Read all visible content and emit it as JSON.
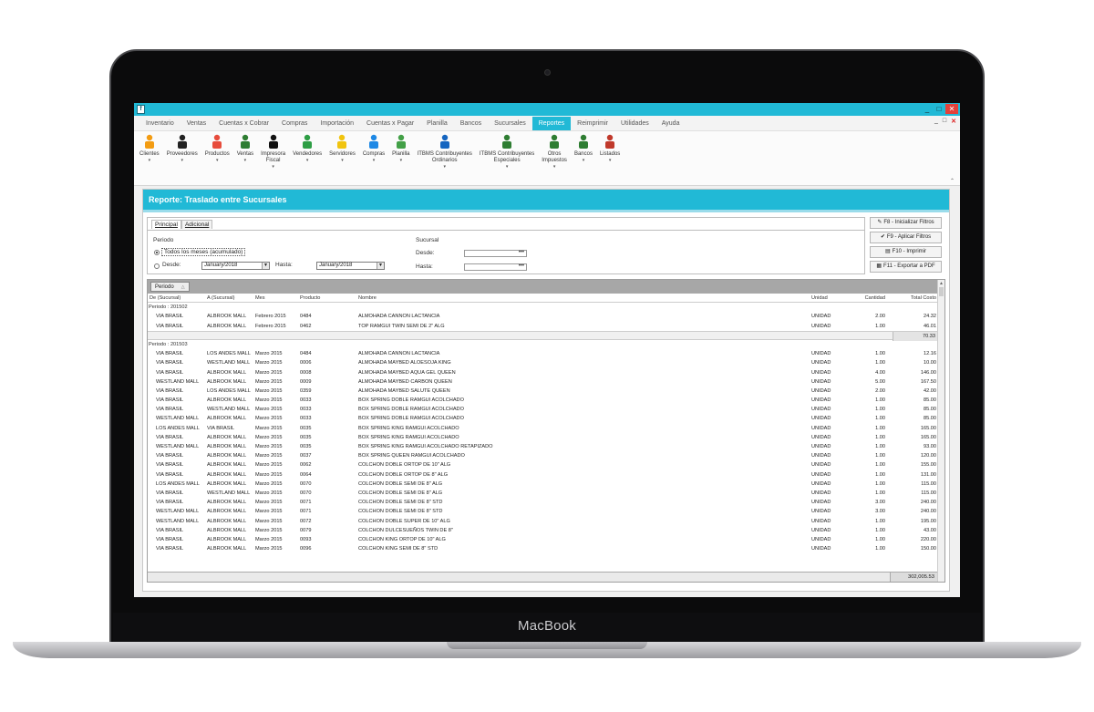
{
  "device_label": "MacBook",
  "window": {
    "app_icon": "f",
    "controls": [
      "_",
      "□",
      "✕"
    ],
    "mdi_controls": [
      "_",
      "□",
      "✕"
    ]
  },
  "menus": [
    "Inventario",
    "Ventas",
    "Cuentas x Cobrar",
    "Compras",
    "Importación",
    "Cuentas x Pagar",
    "Planilla",
    "Bancos",
    "Sucursales",
    "Reportes",
    "Reimprimir",
    "Utilidades",
    "Ayuda"
  ],
  "active_menu": "Reportes",
  "ribbon": [
    {
      "label": "Clientes",
      "icon": "person-orange-icon",
      "color": "#f39c12"
    },
    {
      "label": "Proveedores",
      "icon": "person-black-icon",
      "color": "#222222"
    },
    {
      "label": "Productos",
      "icon": "products-icon",
      "color": "#e74c3c"
    },
    {
      "label": "Ventas",
      "icon": "sales-icon",
      "color": "#2e7d32"
    },
    {
      "label": "Impresora\nFiscal",
      "icon": "printer-icon",
      "color": "#111111"
    },
    {
      "label": "Vendedores",
      "icon": "person-green-icon",
      "color": "#2e9e45"
    },
    {
      "label": "Servidores",
      "icon": "person-yellow-icon",
      "color": "#f1c40f"
    },
    {
      "label": "Compras",
      "icon": "purchases-icon",
      "color": "#1e88e5"
    },
    {
      "label": "Planilla",
      "icon": "payroll-icon",
      "color": "#43a047"
    },
    {
      "label": "ITBMS Contribuyentes\nOrdinarios",
      "icon": "tax-ordinary-icon",
      "color": "#1565c0"
    },
    {
      "label": "ITBMS Contribuyentes\nEspeciales",
      "icon": "tax-special-icon",
      "color": "#2e7d32"
    },
    {
      "label": "Otros\nImpuestos",
      "icon": "other-taxes-icon",
      "color": "#2e7d32"
    },
    {
      "label": "Bancos",
      "icon": "bank-icon",
      "color": "#2e7d32"
    },
    {
      "label": "Listados",
      "icon": "listings-icon",
      "color": "#c0392b"
    }
  ],
  "report": {
    "title": "Reporte: Traslado entre Sucursales",
    "tabs": [
      "Principal",
      "Adicional"
    ],
    "periodo_label": "Periodo",
    "option_all": "Todos los meses (acumulado)",
    "desde_label": "Desde:",
    "desde_value": "January/2018",
    "hasta_label": "Hasta:",
    "hasta_value": "January/2018",
    "sucursal_label": "Sucursal",
    "suc_desde_label": "Desde:",
    "suc_hasta_label": "Hasta:",
    "field_btn": "•••",
    "buttons": [
      "F8 - Inicializar Filtros",
      "F9 - Aplicar Filtros",
      "F10 - Imprimir",
      "F11 - Exportar a PDF"
    ]
  },
  "grid": {
    "group_chip": "Periodo",
    "columns": [
      "De (Sucursal)",
      "A (Sucursal)",
      "Mes",
      "Producto",
      "Nombre",
      "Unidad",
      "Cantidad",
      "Total Costo"
    ],
    "groups": [
      {
        "label": "Periodo : 201502",
        "subtotal": "70.33",
        "rows": [
          [
            "VIA BRASIL",
            "ALBROOK MALL",
            "Febrero 2015",
            "0484",
            "ALMOHADA CANNON LACTANCIA",
            "UNIDAD",
            "2.00",
            "24.32"
          ],
          [
            "VIA BRASIL",
            "ALBROOK MALL",
            "Febrero 2015",
            "0462",
            "TOP RAMGUI TWIN SEMI DE 2\" ALG",
            "UNIDAD",
            "1.00",
            "46.01"
          ]
        ]
      },
      {
        "label": "Periodo : 201503",
        "rows": [
          [
            "VIA BRASIL",
            "LOS ANDES MALL",
            "Marzo 2015",
            "0484",
            "ALMOHADA CANNON LACTANCIA",
            "UNIDAD",
            "1.00",
            "12.16"
          ],
          [
            "VIA BRASIL",
            "WESTLAND MALL",
            "Marzo 2015",
            "0006",
            "ALMOHADA MAYBED ALOESOJA KING",
            "UNIDAD",
            "1.00",
            "10.00"
          ],
          [
            "VIA BRASIL",
            "ALBROOK MALL",
            "Marzo 2015",
            "0008",
            "ALMOHADA MAYBED AQUA GEL QUEEN",
            "UNIDAD",
            "4.00",
            "146.00"
          ],
          [
            "WESTLAND MALL",
            "ALBROOK MALL",
            "Marzo 2015",
            "0009",
            "ALMOHADA MAYBED CARBON QUEEN",
            "UNIDAD",
            "5.00",
            "167.50"
          ],
          [
            "VIA BRASIL",
            "LOS ANDES MALL",
            "Marzo 2015",
            "0359",
            "ALMOHADA MAYBED SALUTE QUEEN",
            "UNIDAD",
            "2.00",
            "42.00"
          ],
          [
            "VIA BRASIL",
            "ALBROOK MALL",
            "Marzo 2015",
            "0033",
            "BOX SPRING DOBLE RAMGUI ACOLCHADO",
            "UNIDAD",
            "1.00",
            "85.00"
          ],
          [
            "VIA BRASIL",
            "WESTLAND MALL",
            "Marzo 2015",
            "0033",
            "BOX SPRING DOBLE RAMGUI ACOLCHADO",
            "UNIDAD",
            "1.00",
            "85.00"
          ],
          [
            "WESTLAND MALL",
            "ALBROOK MALL",
            "Marzo 2015",
            "0033",
            "BOX SPRING DOBLE RAMGUI ACOLCHADO",
            "UNIDAD",
            "1.00",
            "85.00"
          ],
          [
            "LOS ANDES MALL",
            "VIA BRASIL",
            "Marzo 2015",
            "0035",
            "BOX SPRING KING RAMGUI ACOLCHADO",
            "UNIDAD",
            "1.00",
            "165.00"
          ],
          [
            "VIA BRASIL",
            "ALBROOK MALL",
            "Marzo 2015",
            "0035",
            "BOX SPRING KING RAMGUI ACOLCHADO",
            "UNIDAD",
            "1.00",
            "165.00"
          ],
          [
            "WESTLAND MALL",
            "ALBROOK MALL",
            "Marzo 2015",
            "0035",
            "BOX SPRING KING RAMGUI ACOLCHADO RETAPIZADO",
            "UNIDAD",
            "1.00",
            "93.00"
          ],
          [
            "VIA BRASIL",
            "ALBROOK MALL",
            "Marzo 2015",
            "0037",
            "BOX SPRING QUEEN RAMGUI ACOLCHADO",
            "UNIDAD",
            "1.00",
            "120.00"
          ],
          [
            "VIA BRASIL",
            "ALBROOK MALL",
            "Marzo 2015",
            "0062",
            "COLCHON DOBLE ORTOP DE 10\" ALG",
            "UNIDAD",
            "1.00",
            "155.00"
          ],
          [
            "VIA BRASIL",
            "ALBROOK MALL",
            "Marzo 2015",
            "0064",
            "COLCHON DOBLE ORTOP DE 8\" ALG",
            "UNIDAD",
            "1.00",
            "131.00"
          ],
          [
            "LOS ANDES MALL",
            "ALBROOK MALL",
            "Marzo 2015",
            "0070",
            "COLCHON DOBLE SEMI DE 8\" ALG",
            "UNIDAD",
            "1.00",
            "115.00"
          ],
          [
            "VIA BRASIL",
            "WESTLAND MALL",
            "Marzo 2015",
            "0070",
            "COLCHON DOBLE SEMI DE 8\" ALG",
            "UNIDAD",
            "1.00",
            "115.00"
          ],
          [
            "VIA BRASIL",
            "ALBROOK MALL",
            "Marzo 2015",
            "0071",
            "COLCHON DOBLE SEMI DE 8\" STD",
            "UNIDAD",
            "3.00",
            "240.00"
          ],
          [
            "WESTLAND MALL",
            "ALBROOK MALL",
            "Marzo 2015",
            "0071",
            "COLCHON DOBLE SEMI DE 8\" STD",
            "UNIDAD",
            "3.00",
            "240.00"
          ],
          [
            "WESTLAND MALL",
            "ALBROOK MALL",
            "Marzo 2015",
            "0072",
            "COLCHON DOBLE SUPER DE 10\" ALG",
            "UNIDAD",
            "1.00",
            "195.00"
          ],
          [
            "VIA BRASIL",
            "ALBROOK MALL",
            "Marzo 2015",
            "0079",
            "COLCHON DULCESUEÑOS TWIN DE 8\"",
            "UNIDAD",
            "1.00",
            "43.00"
          ],
          [
            "VIA BRASIL",
            "ALBROOK MALL",
            "Marzo 2015",
            "0093",
            "COLCHON KING ORTOP DE 10\" ALG",
            "UNIDAD",
            "1.00",
            "220.00"
          ],
          [
            "VIA BRASIL",
            "ALBROOK MALL",
            "Marzo 2015",
            "0096",
            "COLCHON KING SEMI DE 8\" STD",
            "UNIDAD",
            "1.00",
            "150.00"
          ]
        ]
      }
    ],
    "grand_total": "302,005.53"
  }
}
